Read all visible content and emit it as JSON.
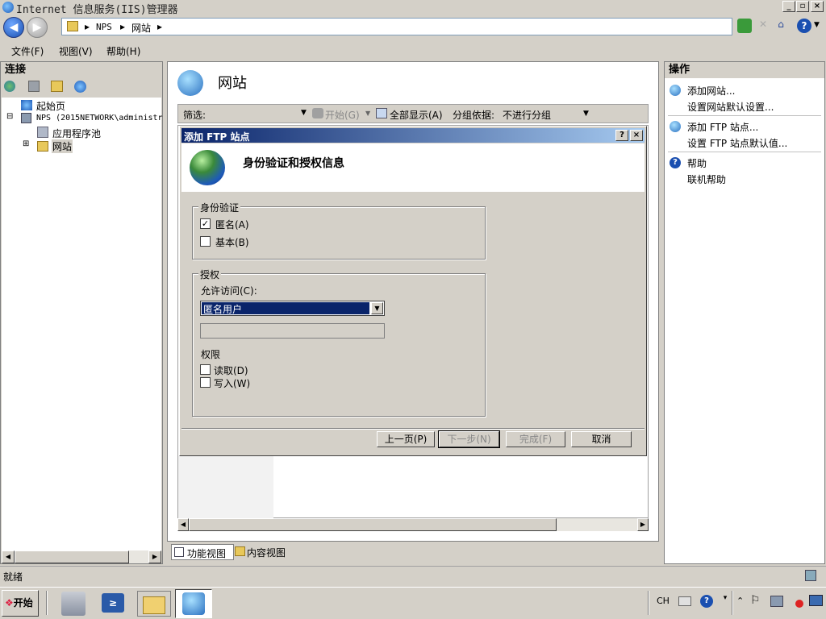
{
  "window": {
    "title": "Internet 信息服务(IIS)管理器"
  },
  "address": {
    "segments": [
      "NPS",
      "网站"
    ]
  },
  "menu": {
    "file": "文件(F)",
    "view": "视图(V)",
    "help": "帮助(H)"
  },
  "connections": {
    "header": "连接",
    "tree": [
      "起始页",
      "NPS (2015NETWORK\\administr",
      "应用程序池",
      "网站"
    ]
  },
  "main": {
    "title": "网站",
    "filter_label": "筛选:",
    "start_label": "开始(G)",
    "show_all_label": "全部显示(A)",
    "group_by_label": "分组依据:",
    "group_by_value": "不进行分组",
    "tab_features": "功能视图",
    "tab_content": "内容视图"
  },
  "dialog": {
    "title": "添加 FTP 站点",
    "heading": "身份验证和授权信息",
    "auth_group": "身份验证",
    "anonymous_label": "匿名(A)",
    "anonymous_checked": true,
    "basic_label": "基本(B)",
    "basic_checked": false,
    "authz_group": "授权",
    "allow_access_label": "允许访问(C):",
    "allow_access_value": "匿名用户",
    "permissions_label": "权限",
    "read_label": "读取(D)",
    "read_checked": false,
    "write_label": "写入(W)",
    "write_checked": false,
    "prev_button": "上一页(P)",
    "next_button": "下一步(N)",
    "finish_button": "完成(F)",
    "cancel_button": "取消",
    "help_button": "?",
    "close_button": "×"
  },
  "actions": {
    "header": "操作",
    "add_website": "添加网站...",
    "website_defaults": "设置网站默认设置...",
    "add_ftp": "添加 FTP 站点...",
    "ftp_defaults": "设置 FTP 站点默认值...",
    "help": "帮助",
    "online_help": "联机帮助"
  },
  "status": {
    "text": "就绪"
  },
  "taskbar": {
    "start": "开始",
    "lang": "CH"
  },
  "colors": {
    "dialog_title_start": "#0a246a",
    "dialog_title_end": "#a6caf0",
    "selection": "#0a246a"
  }
}
